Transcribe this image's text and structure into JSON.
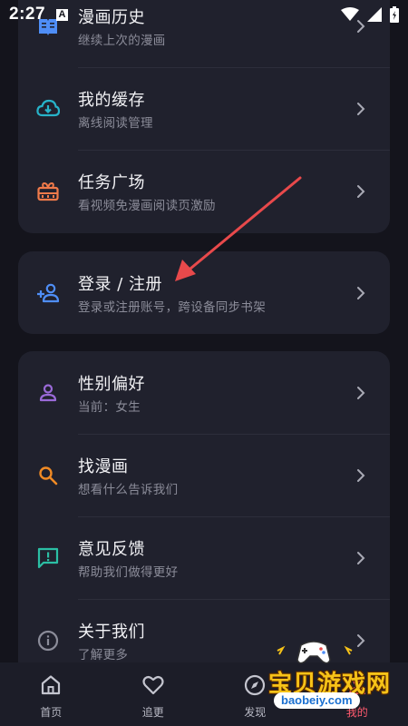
{
  "status_bar": {
    "time": "2:27",
    "notification_glyph": "A",
    "icons": [
      "wifi-icon",
      "signal-icon",
      "battery-icon"
    ]
  },
  "groups": [
    {
      "items": [
        {
          "title": "漫画历史",
          "subtitle": "继续上次的漫画",
          "icon": "book-icon",
          "icon_color": "#4f8ef7"
        },
        {
          "title": "我的缓存",
          "subtitle": "离线阅读管理",
          "icon": "cloud-download-icon",
          "icon_color": "#27b3c9"
        },
        {
          "title": "任务广场",
          "subtitle": "看视频免漫画阅读页激励",
          "icon": "gift-icon",
          "icon_color": "#f07a4a"
        }
      ]
    },
    {
      "items": [
        {
          "title": "登录 / 注册",
          "subtitle": "登录或注册账号，跨设备同步书架",
          "icon": "add-user-icon",
          "icon_color": "#4f8ef7"
        }
      ]
    },
    {
      "items": [
        {
          "title": "性别偏好",
          "subtitle": "当前：女生",
          "icon": "person-icon",
          "icon_color": "#9a6ad8"
        },
        {
          "title": "找漫画",
          "subtitle": "想看什么告诉我们",
          "icon": "search-icon",
          "icon_color": "#f08a24"
        },
        {
          "title": "意见反馈",
          "subtitle": "帮助我们做得更好",
          "icon": "feedback-icon",
          "icon_color": "#2bbfa4"
        },
        {
          "title": "关于我们",
          "subtitle": "了解更多",
          "icon": "info-icon",
          "icon_color": "#8b8c99"
        }
      ]
    }
  ],
  "tabs": [
    {
      "label": "首页",
      "icon": "home-icon",
      "active": false
    },
    {
      "label": "追更",
      "icon": "heart-icon",
      "active": false
    },
    {
      "label": "发现",
      "icon": "discover-icon",
      "active": false
    },
    {
      "label": "我的",
      "icon": "profile-icon",
      "active": true
    }
  ],
  "watermark": {
    "text": "宝贝游戏网",
    "url": "baobeiy.com"
  },
  "colors": {
    "background": "#14141c",
    "card": "#20212d",
    "accent": "#ff5a6e",
    "arrow": "#e8494b"
  }
}
